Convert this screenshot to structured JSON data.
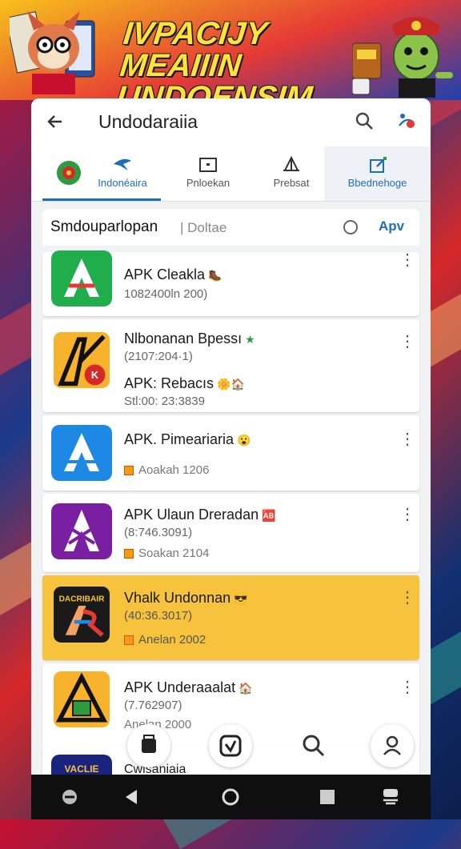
{
  "banner": {
    "title_line1": "IVPACIJY MEAIIIN",
    "title_line2": "UNDOENSIM"
  },
  "appbar": {
    "title": "Undodaraiia",
    "back_icon": "arrow-left-icon",
    "search_icon": "search-icon",
    "share_icon": "share-icon"
  },
  "tabs": [
    {
      "label": "Indonéaira",
      "icon": "bird-logo-icon",
      "active": true
    },
    {
      "label": "Pnloekan",
      "icon": "window-icon",
      "active": false
    },
    {
      "label": "Prebsat",
      "icon": "ship-icon",
      "active": false
    },
    {
      "label": "Bbednehoge",
      "icon": "edit-icon",
      "active": false
    }
  ],
  "filter": {
    "label": "Smdouparlopan",
    "sub": "| Doltae",
    "apply": "Apv"
  },
  "apps": [
    {
      "name": "APK Cleakla",
      "badge": "🥾",
      "meta": "1082400ln 200)",
      "tag": "",
      "icon_color": "#1fae4b"
    },
    {
      "name": "Nlbonanan Bpessı",
      "badge": "★",
      "meta": "(2107:204·1)",
      "name2": "APK: Rebacıs",
      "badge2": "🌼🏠",
      "meta2": "Stl:00: 23:3839",
      "icon_color": "#f7b32b"
    },
    {
      "name": "APK. Pimeariaria",
      "badge": "😮",
      "meta": "",
      "tag": "Aoakah 1206",
      "icon_color": "#1e88e5"
    },
    {
      "name": "APK Ulaun Dreradan",
      "badge": "🆎",
      "meta": "(8:746.3091)",
      "tag": "Soakan 2104",
      "icon_color": "#7b1fa2"
    },
    {
      "name": "Vhalk Undonnan",
      "badge": "😎",
      "meta": "(40:36.3017)",
      "tag": "Anelan 2002",
      "icon_color": "#1a1a1a",
      "icon_text": "DACRIBAIR"
    },
    {
      "name": "APK Underaaalat",
      "badge": "🏠",
      "meta": "(7.762907)",
      "tag": "Anelan 2000",
      "icon_color": "#f7b32b"
    },
    {
      "name": "Cwisaniaia",
      "icon_text": "VACLIE"
    }
  ],
  "fabs": [
    "shopping-bag-icon",
    "shield-check-icon",
    "search-icon",
    "user-icon"
  ],
  "nav": [
    "recent-apps-icon",
    "back-triangle-icon",
    "home-circle-icon",
    "overview-square-icon",
    "assistant-icon"
  ]
}
